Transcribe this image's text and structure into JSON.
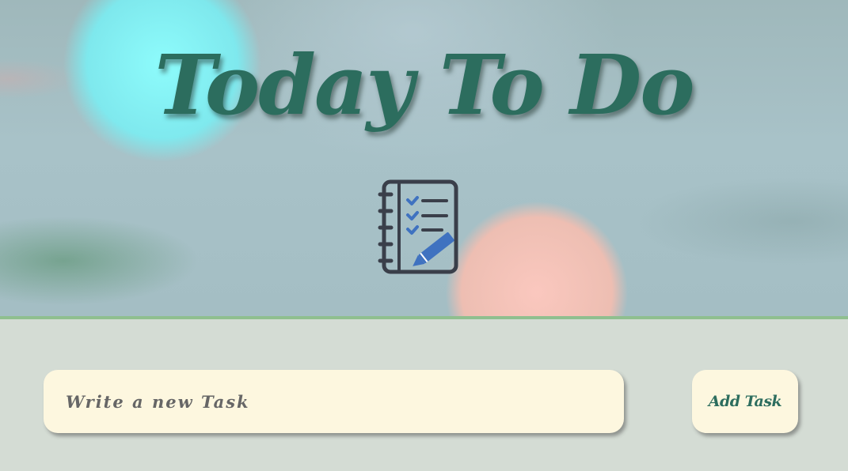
{
  "header": {
    "title": "Today To Do",
    "icon": "notebook-checklist-pencil-icon"
  },
  "task_form": {
    "input_placeholder": "Write a new Task",
    "input_value": "",
    "add_button_label": "Add Task"
  },
  "colors": {
    "title": "#2c6d5e",
    "input_background": "#fdf7df",
    "page_background": "#d4dcd4",
    "divider": "#8fbf8f",
    "icon_dark": "#3a3f4a",
    "icon_accent": "#3f72c0"
  }
}
